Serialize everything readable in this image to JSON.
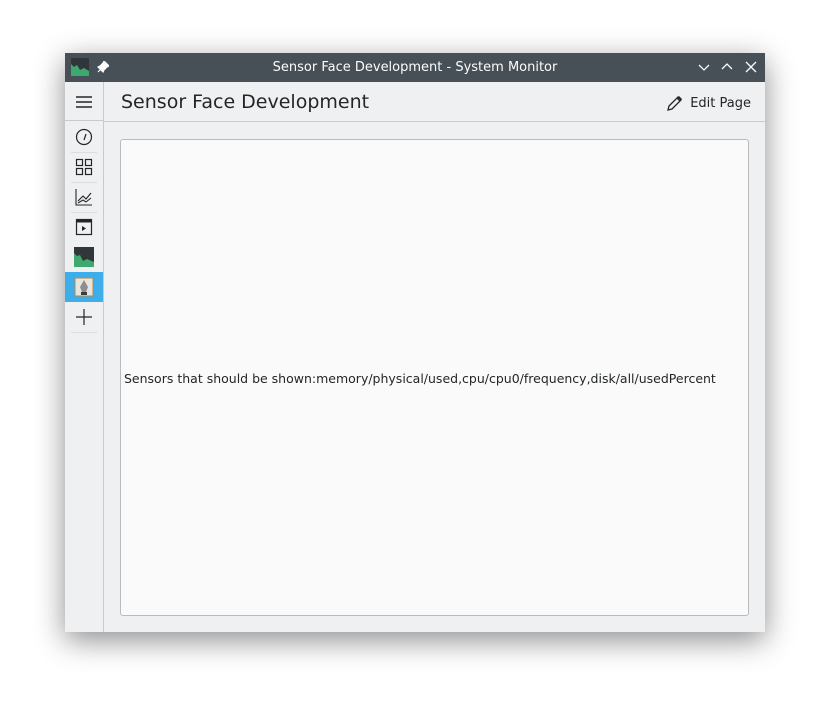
{
  "window": {
    "title": "Sensor Face Development - System Monitor"
  },
  "header": {
    "title": "Sensor Face Development",
    "edit_label": "Edit Page"
  },
  "sidebar": {
    "items": [
      {
        "icon": "menu-icon"
      },
      {
        "icon": "gauge-icon"
      },
      {
        "icon": "grid-icon"
      },
      {
        "icon": "line-chart-icon"
      },
      {
        "icon": "application-window-icon"
      },
      {
        "icon": "system-monitor-icon"
      },
      {
        "icon": "pen-document-icon",
        "selected": true
      },
      {
        "icon": "add-icon"
      }
    ]
  },
  "main": {
    "message": "Sensors that should be shown:memory/physical/used,cpu/cpu0/frequency,disk/all/usedPercent"
  },
  "colors": {
    "titlebar": "#475057",
    "accent": "#3daee9",
    "background": "#eff0f1"
  }
}
